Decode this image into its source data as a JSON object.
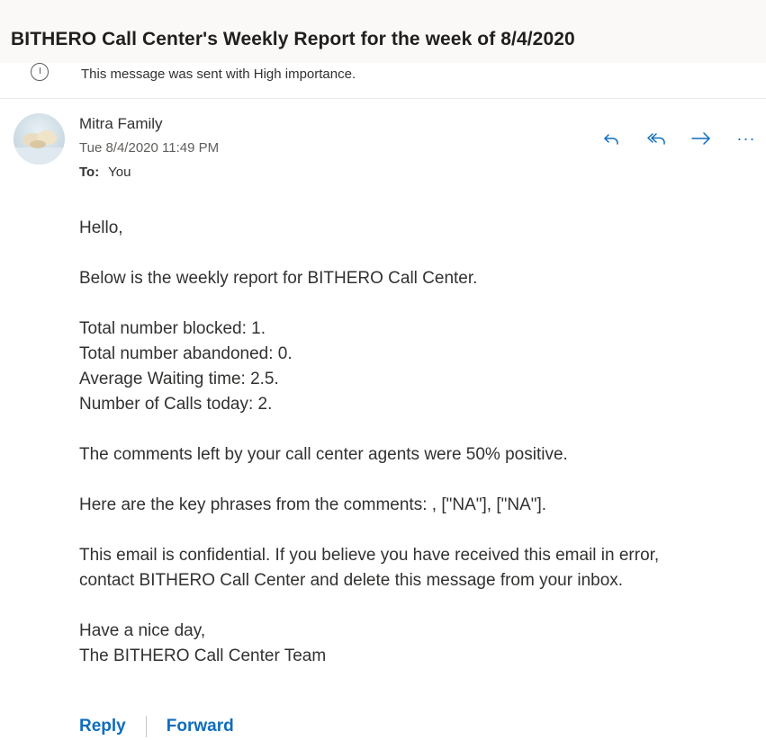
{
  "subject": "BITHERO Call Center's Weekly Report for the week of 8/4/2020",
  "importance_notice": "This message was sent with High importance.",
  "sender": {
    "name": "Mitra Family",
    "datetime": "Tue 8/4/2020 11:49 PM",
    "to_label": "To:",
    "to_value": "You"
  },
  "actions": {
    "reply_icon": "reply-icon",
    "reply_all_icon": "reply-all-icon",
    "forward_icon": "forward-icon",
    "more_icon": "more-icon",
    "more_label": "···"
  },
  "body": {
    "greeting": "Hello,",
    "intro": "Below is the weekly report for BITHERO Call Center.",
    "stats": [
      "Total number blocked: 1.",
      "Total number abandoned: 0.",
      "Average Waiting time: 2.5.",
      "Number of Calls today: 2."
    ],
    "sentiment": "The comments left by your call center agents were 50% positive.",
    "key_phrases": "Here are the key phrases from the comments: , [\"NA\"], [\"NA\"].",
    "confidential_line1": "This email is confidential. If you believe you have received this email in error,",
    "confidential_line2": "contact BITHERO Call Center and delete this message from your inbox.",
    "closing": "Have a nice day,",
    "signature": "The BITHERO Call Center Team"
  },
  "footer": {
    "reply_label": "Reply",
    "forward_label": "Forward"
  },
  "colors": {
    "accent": "#0f6cbd",
    "subject_bar": "#faf9f8",
    "text": "#323130",
    "muted": "#605e5c"
  }
}
